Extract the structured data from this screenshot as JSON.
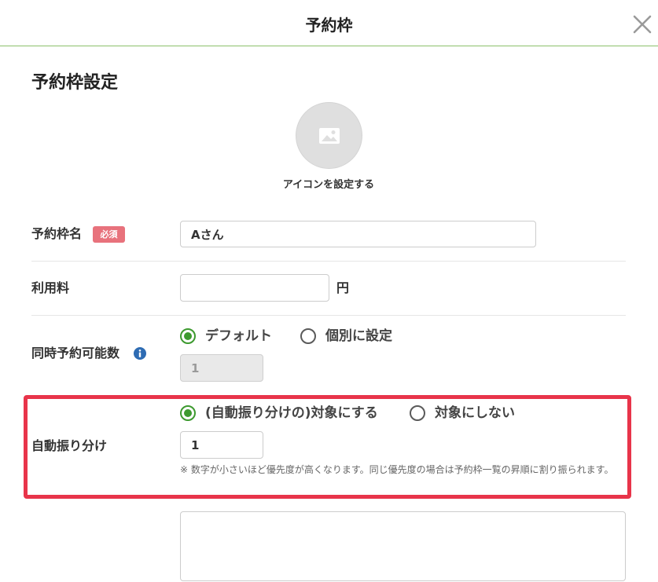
{
  "header": {
    "title": "予約枠",
    "close_icon": "close-icon"
  },
  "section": {
    "title": "予約枠設定"
  },
  "icon_upload": {
    "icon": "image-icon",
    "label": "アイコンを設定する"
  },
  "form": {
    "name": {
      "label": "予約枠名",
      "required_badge": "必須",
      "value": "Aさん"
    },
    "fee": {
      "label": "利用料",
      "value": "",
      "unit": "円"
    },
    "capacity": {
      "label": "同時予約可能数",
      "info_icon": "info-icon",
      "options": [
        {
          "label": "デフォルト",
          "checked": true
        },
        {
          "label": "個別に設定",
          "checked": false
        }
      ],
      "value": "1",
      "disabled": true
    },
    "auto_assign": {
      "label": "自動振り分け",
      "options": [
        {
          "label": "(自動振り分けの)対象にする",
          "checked": true
        },
        {
          "label": "対象にしない",
          "checked": false
        }
      ],
      "value": "1",
      "note": "※ 数字が小さいほど優先度が高くなります。同じ優先度の場合は予約枠一覧の昇順に割り振られます。"
    },
    "memo": {
      "value": ""
    }
  },
  "colors": {
    "accent": "#3d9a2f",
    "header_rule": "#8cc06a",
    "required_badge": "#e8727c",
    "highlight": "#e8344a",
    "info": "#2e6cb3"
  }
}
